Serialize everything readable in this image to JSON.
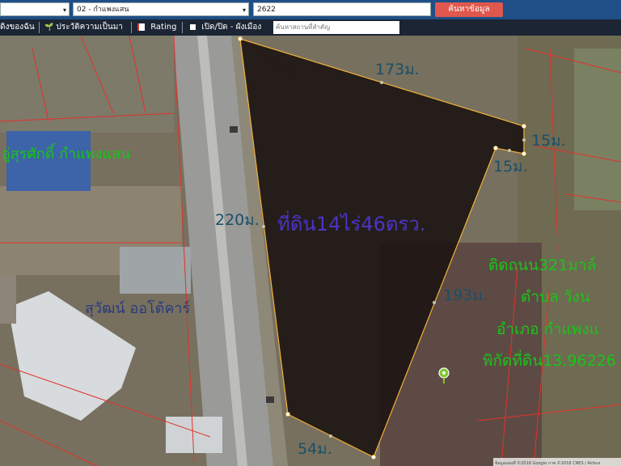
{
  "toolbar_top": {
    "province_select": "",
    "district_select": "02 - กำแพงแสน",
    "search_value": "2622",
    "search_button": "ค้นหาข้อมูล"
  },
  "toolbar": {
    "item_land": "ดิงของฉัน",
    "item_history": "ประวัติความเป็นมา",
    "item_rating": "Rating",
    "item_toggle": "เปิด/ปิด - ผังเมือง",
    "search_placeholder": "ค้นหาสถานที่สำคัญ"
  },
  "map": {
    "plot_label": "ที่ดิน14ไร่46ตรว.",
    "dimensions": {
      "top": "173ม.",
      "right_top": "15ม.",
      "right_inner": "15ม.",
      "left": "220ม.",
      "right": "193ม.",
      "bottom": "54ม."
    },
    "place_labels": {
      "shop1": "อู่สุรศักดิ์ กำแพงแสน",
      "shop2": "สุวัฒน์ ออโต้คาร์"
    },
    "info_lines": [
      "ติดถนน321มาล์",
      "ตำบล วังน",
      "อำเภอ กำแพงแ",
      "พิกัดที่ดิน13.96226"
    ],
    "attribution": "ข้อมูลแผนที่ ©2018 Google ภาพ ©2018 CNES / Airbus",
    "colors": {
      "dimension_text": "#1b4f68",
      "plot_text": "#4a34c8",
      "green_text": "#19c419",
      "boundary": "#f0b13a",
      "parcel_line": "#e3322b"
    }
  }
}
